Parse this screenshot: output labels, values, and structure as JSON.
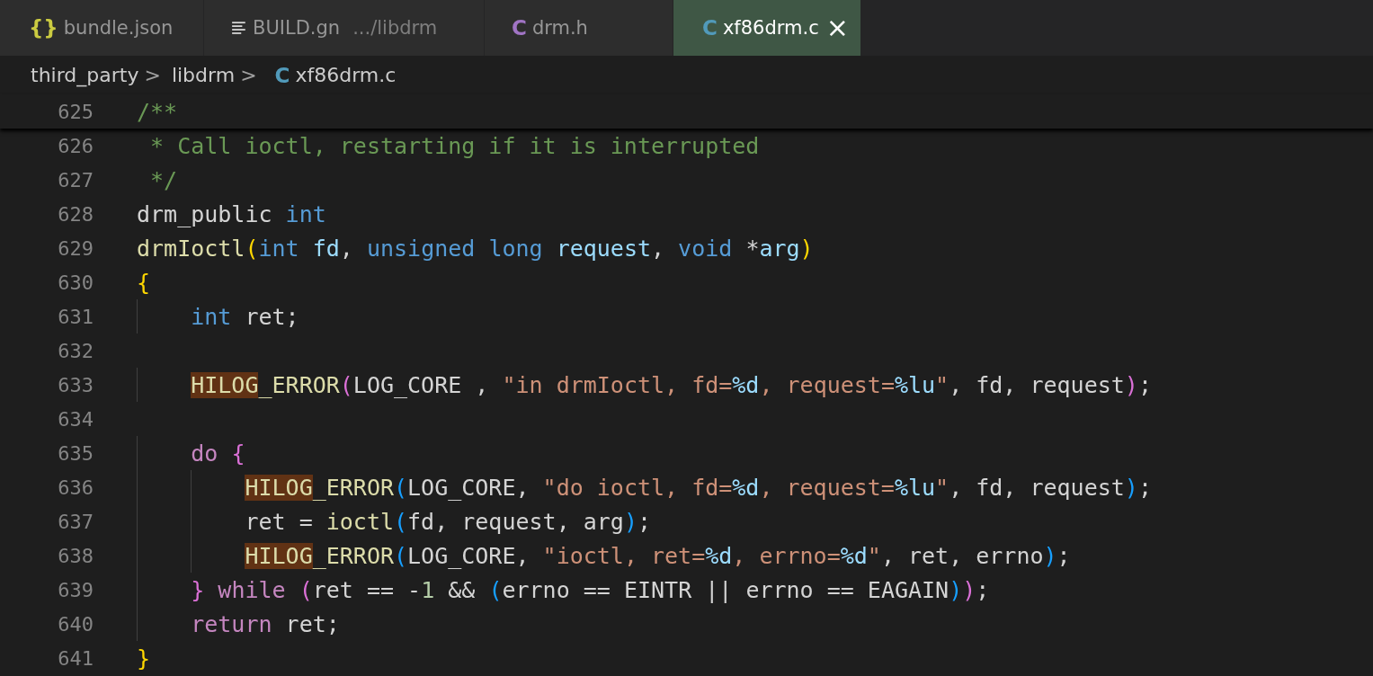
{
  "tabs": [
    {
      "label": "bundle.json",
      "kind": "glyph",
      "icon": "{}",
      "color": "#cbcb41",
      "selected": false
    },
    {
      "label": "BUILD.gn",
      "detail": ".../libdrm",
      "kind": "lines",
      "color": "#d4d4d4",
      "selected": false
    },
    {
      "label": "drm.h",
      "kind": "glyph",
      "icon": "C",
      "color": "#a074c4",
      "selected": false
    },
    {
      "label": "xf86drm.c",
      "kind": "glyph",
      "icon": "C",
      "color": "#519aba",
      "selected": true,
      "close": "×"
    }
  ],
  "breadcrumb": {
    "items": [
      "third_party",
      "libdrm"
    ],
    "separator": ">",
    "file": {
      "icon": "C",
      "color": "#519aba",
      "label": "xf86drm.c"
    }
  },
  "code": [
    {
      "number": "625",
      "tokens": [
        {
          "t": "/**",
          "kind": "comment"
        }
      ]
    },
    {
      "number": "626",
      "tokens": [
        {
          "t": " * Call ioctl, restarting if it is interrupted",
          "kind": "comment"
        }
      ]
    },
    {
      "number": "627",
      "tokens": [
        {
          "t": " */",
          "kind": "comment"
        }
      ]
    },
    {
      "number": "628",
      "tokens": [
        {
          "t": "drm_public ",
          "kind": "plain"
        },
        {
          "t": "int",
          "kind": "type"
        }
      ]
    },
    {
      "number": "629",
      "tokens": [
        {
          "t": "drmIoctl",
          "kind": "func"
        },
        {
          "t": "(",
          "kind": "paren1"
        },
        {
          "t": "int ",
          "kind": "type"
        },
        {
          "t": "fd",
          "kind": "param"
        },
        {
          "t": ", ",
          "kind": "plain"
        },
        {
          "t": "unsigned long ",
          "kind": "type"
        },
        {
          "t": "request",
          "kind": "param"
        },
        {
          "t": ", ",
          "kind": "plain"
        },
        {
          "t": "void ",
          "kind": "type"
        },
        {
          "t": "*",
          "kind": "plain"
        },
        {
          "t": "arg",
          "kind": "param"
        },
        {
          "t": ")",
          "kind": "paren1"
        }
      ]
    },
    {
      "number": "630",
      "tokens": [
        {
          "t": "{",
          "kind": "paren1"
        }
      ]
    },
    {
      "number": "631",
      "tokens": [
        {
          "t": "    int ",
          "kind": "type"
        },
        {
          "t": "ret;",
          "kind": "plain"
        }
      ]
    },
    {
      "number": "632"
    },
    {
      "number": "633",
      "tokens": [
        {
          "t": "    HILOG",
          "kind": "hl"
        },
        {
          "t": "_ERROR",
          "kind": "func"
        },
        {
          "t": "(",
          "kind": "paren2"
        },
        {
          "t": "LOG_CORE , ",
          "kind": "plain"
        },
        {
          "t": "\"in drmIoctl, fd=",
          "kind": "string"
        },
        {
          "t": "%d",
          "kind": "param"
        },
        {
          "t": ", request=",
          "kind": "string"
        },
        {
          "t": "%lu",
          "kind": "param"
        },
        {
          "t": "\"",
          "kind": "string"
        },
        {
          "t": ", fd, request",
          "kind": "plain"
        },
        {
          "t": ")",
          "kind": "paren2"
        },
        {
          "t": ";",
          "kind": "plain"
        }
      ]
    },
    {
      "number": "634"
    },
    {
      "number": "635",
      "tokens": [
        {
          "t": "    do ",
          "kind": "keyword"
        },
        {
          "t": "{",
          "kind": "paren2"
        }
      ]
    },
    {
      "number": "636",
      "tokens": [
        {
          "t": "        HILOG",
          "kind": "hl"
        },
        {
          "t": "_ERROR",
          "kind": "func"
        },
        {
          "t": "(",
          "kind": "paren3"
        },
        {
          "t": "LOG_CORE, ",
          "kind": "plain"
        },
        {
          "t": "\"do ioctl, fd=",
          "kind": "string"
        },
        {
          "t": "%d",
          "kind": "param"
        },
        {
          "t": ", request=",
          "kind": "string"
        },
        {
          "t": "%lu",
          "kind": "param"
        },
        {
          "t": "\"",
          "kind": "string"
        },
        {
          "t": ", fd, request",
          "kind": "plain"
        },
        {
          "t": ")",
          "kind": "paren3"
        },
        {
          "t": ";",
          "kind": "plain"
        }
      ]
    },
    {
      "number": "637",
      "tokens": [
        {
          "t": "        ret = ",
          "kind": "plain"
        },
        {
          "t": "ioctl",
          "kind": "func"
        },
        {
          "t": "(",
          "kind": "paren3"
        },
        {
          "t": "fd, request, arg",
          "kind": "plain"
        },
        {
          "t": ")",
          "kind": "paren3"
        },
        {
          "t": ";",
          "kind": "plain"
        }
      ]
    },
    {
      "number": "638",
      "tokens": [
        {
          "t": "        HILOG",
          "kind": "hl"
        },
        {
          "t": "_ERROR",
          "kind": "func"
        },
        {
          "t": "(",
          "kind": "paren3"
        },
        {
          "t": "LOG_CORE, ",
          "kind": "plain"
        },
        {
          "t": "\"ioctl, ret=",
          "kind": "string"
        },
        {
          "t": "%d",
          "kind": "param"
        },
        {
          "t": ", errno=",
          "kind": "string"
        },
        {
          "t": "%d",
          "kind": "param"
        },
        {
          "t": "\"",
          "kind": "string"
        },
        {
          "t": ", ret, errno",
          "kind": "plain"
        },
        {
          "t": ")",
          "kind": "paren3"
        },
        {
          "t": ";",
          "kind": "plain"
        }
      ]
    },
    {
      "number": "639",
      "tokens": [
        {
          "t": "    } ",
          "kind": "paren2"
        },
        {
          "t": "while ",
          "kind": "keyword"
        },
        {
          "t": "(",
          "kind": "paren2"
        },
        {
          "t": "ret == -",
          "kind": "plain"
        },
        {
          "t": "1",
          "kind": "number"
        },
        {
          "t": " && ",
          "kind": "plain"
        },
        {
          "t": "(",
          "kind": "paren3"
        },
        {
          "t": "errno == EINTR || errno == EAGAIN",
          "kind": "plain"
        },
        {
          "t": ")",
          "kind": "paren3"
        },
        {
          "t": ")",
          "kind": "paren2"
        },
        {
          "t": ";",
          "kind": "plain"
        }
      ]
    },
    {
      "number": "640",
      "tokens": [
        {
          "t": "    return ",
          "kind": "keyword"
        },
        {
          "t": "ret;",
          "kind": "plain"
        }
      ]
    },
    {
      "number": "641",
      "tokens": [
        {
          "t": "}",
          "kind": "paren1"
        }
      ]
    }
  ]
}
